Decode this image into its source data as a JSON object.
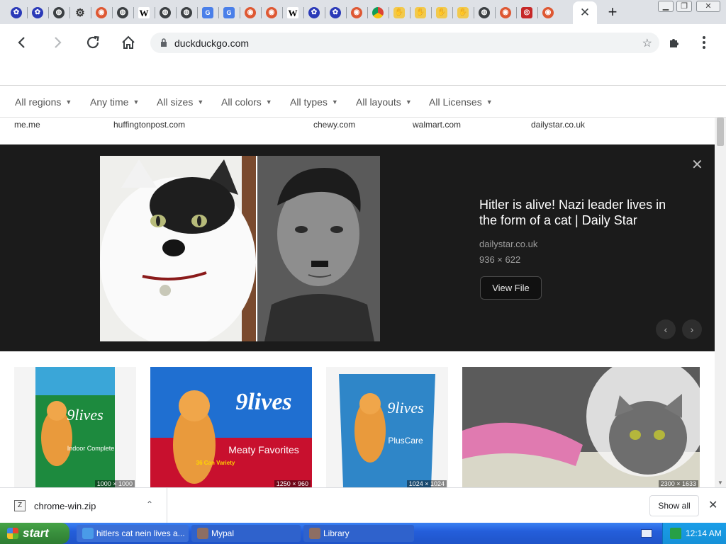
{
  "browser": {
    "tabs": [
      {
        "icon": "paw-icon",
        "glyph": "✿"
      },
      {
        "icon": "paw-icon",
        "glyph": "✿"
      },
      {
        "icon": "globe-icon",
        "glyph": "◍"
      },
      {
        "icon": "gear-icon",
        "glyph": "⚙"
      },
      {
        "icon": "duckduckgo-icon",
        "glyph": "◉"
      },
      {
        "icon": "globe-icon",
        "glyph": "◍"
      },
      {
        "icon": "wikipedia-icon",
        "glyph": "W"
      },
      {
        "icon": "globe-icon",
        "glyph": "◍"
      },
      {
        "icon": "globe-icon",
        "glyph": "◍"
      },
      {
        "icon": "google-translate-icon",
        "glyph": "G"
      },
      {
        "icon": "google-translate-icon",
        "glyph": "G"
      },
      {
        "icon": "duckduckgo-icon",
        "glyph": "◉"
      },
      {
        "icon": "duckduckgo-icon",
        "glyph": "◉"
      },
      {
        "icon": "wikipedia-icon",
        "glyph": "W"
      },
      {
        "icon": "paw-icon",
        "glyph": "✿"
      },
      {
        "icon": "paw-icon",
        "glyph": "✿"
      },
      {
        "icon": "duckduckgo-icon",
        "glyph": "◉"
      },
      {
        "icon": "chrome-icon",
        "glyph": ""
      },
      {
        "icon": "hand-icon",
        "glyph": "✋"
      },
      {
        "icon": "hand-icon",
        "glyph": "✋"
      },
      {
        "icon": "hand-icon",
        "glyph": "✋"
      },
      {
        "icon": "hand-icon",
        "glyph": "✋"
      },
      {
        "icon": "globe-icon",
        "glyph": "◍"
      },
      {
        "icon": "duckduckgo-icon",
        "glyph": "◉"
      },
      {
        "icon": "red-circle-icon",
        "glyph": "◎"
      },
      {
        "icon": "duckduckgo-icon",
        "glyph": "◉"
      }
    ],
    "active_tab_close": "✕",
    "new_tab": "+",
    "window_controls": {
      "minimize": "▁",
      "restore": "❐",
      "close": "✕"
    },
    "address": "duckduckgo.com"
  },
  "filters": [
    {
      "label": "All regions"
    },
    {
      "label": "Any time"
    },
    {
      "label": "All sizes"
    },
    {
      "label": "All colors"
    },
    {
      "label": "All types"
    },
    {
      "label": "All layouts"
    },
    {
      "label": "All Licenses"
    }
  ],
  "sources": [
    "me.me",
    "huffingtonpost.com",
    "chewy.com",
    "walmart.com",
    "dailystar.co.uk"
  ],
  "detail": {
    "title": "Hitler is alive! Nazi leader lives in the form of a cat | Daily Star",
    "domain": "dailystar.co.uk",
    "dimensions": "936 × 622",
    "view_file": "View File",
    "close": "✕",
    "prev": "‹",
    "next": "›"
  },
  "thumbnails": [
    {
      "brand": "9lives",
      "sub": "Indoor Complete",
      "dims": "1000 × 1000"
    },
    {
      "brand": "9lives",
      "sub": "Meaty Favorites",
      "badge": "36 Can Variety",
      "dims": "1250 × 960"
    },
    {
      "brand": "9lives",
      "sub": "PlusCare",
      "dims": "1024 × 1024"
    },
    {
      "brand": "",
      "sub": "",
      "dims": "2300 × 1633"
    }
  ],
  "download": {
    "filename": "chrome-win.zip",
    "caret": "⌃",
    "show_all": "Show all",
    "close": "✕"
  },
  "taskbar": {
    "start": "start",
    "items": [
      {
        "label": "hitlers cat nein lives a...",
        "color": "#3b6fd6"
      },
      {
        "label": "Mypal",
        "color": "#2f62cc"
      },
      {
        "label": "Library",
        "color": "#2f62cc"
      }
    ],
    "clock": "12:14 AM"
  }
}
